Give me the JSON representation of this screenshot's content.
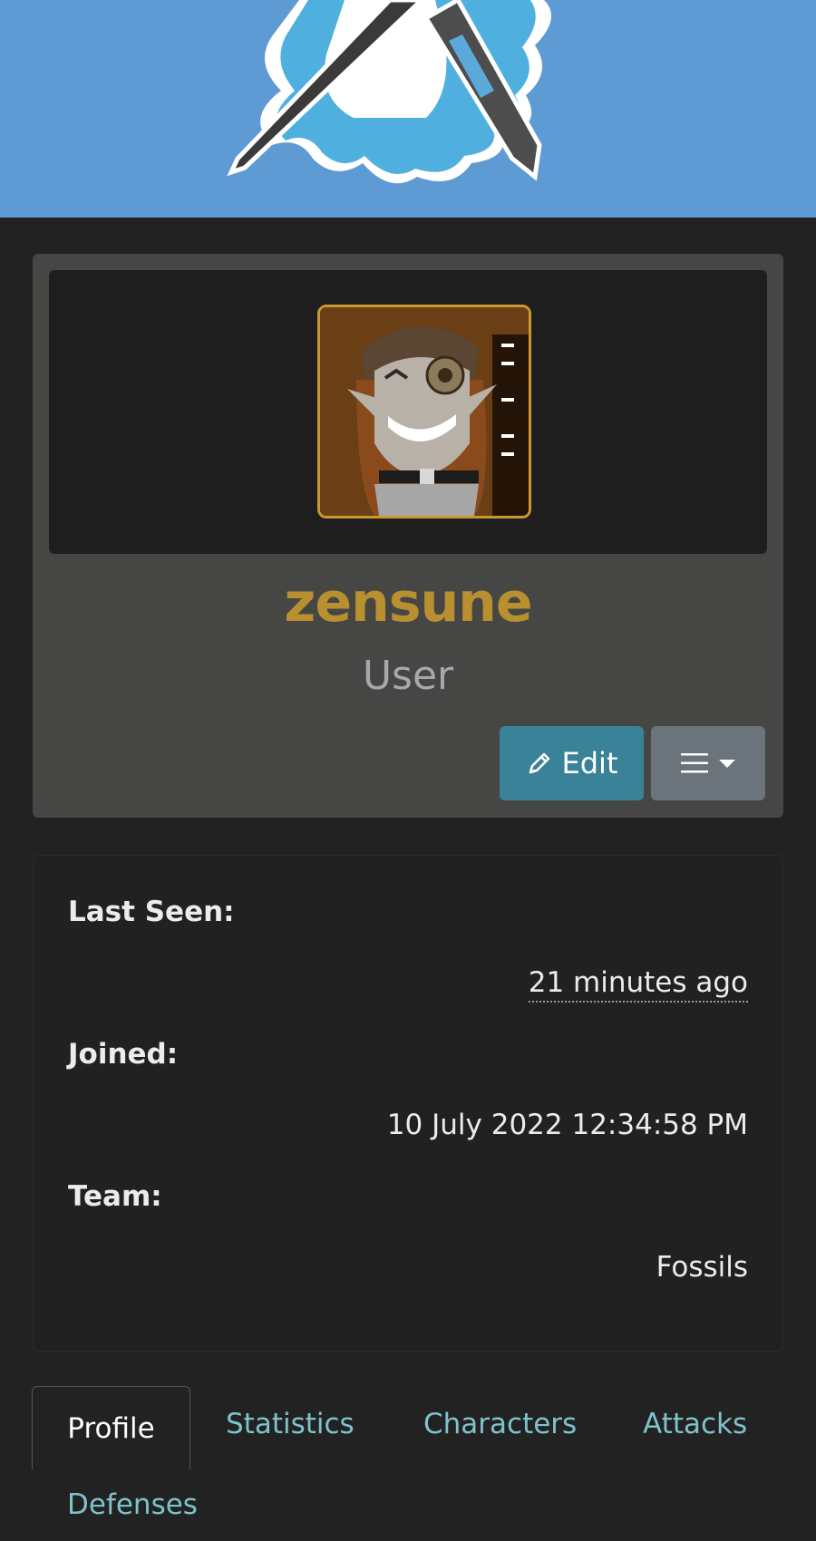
{
  "banner": {
    "logo_icon": "brush-and-pen-splash-logo"
  },
  "profile": {
    "avatar_icon": "steampunk-character-avatar",
    "username": "zensune",
    "role": "User",
    "edit_label": "Edit",
    "edit_icon": "pencil-icon",
    "menu_icon": "hamburger-icon",
    "accent_username": "#b8902f",
    "accent_edit": "#3a8297"
  },
  "info": {
    "last_seen_label": "Last Seen:",
    "last_seen_value": "21 minutes ago",
    "joined_label": "Joined:",
    "joined_value": "10 July 2022 12:34:58 PM",
    "team_label": "Team:",
    "team_value": "Fossils"
  },
  "tabs": [
    {
      "label": "Profile",
      "active": true
    },
    {
      "label": "Statistics",
      "active": false
    },
    {
      "label": "Characters",
      "active": false
    },
    {
      "label": "Attacks",
      "active": false
    },
    {
      "label": "Defenses",
      "active": false
    }
  ]
}
